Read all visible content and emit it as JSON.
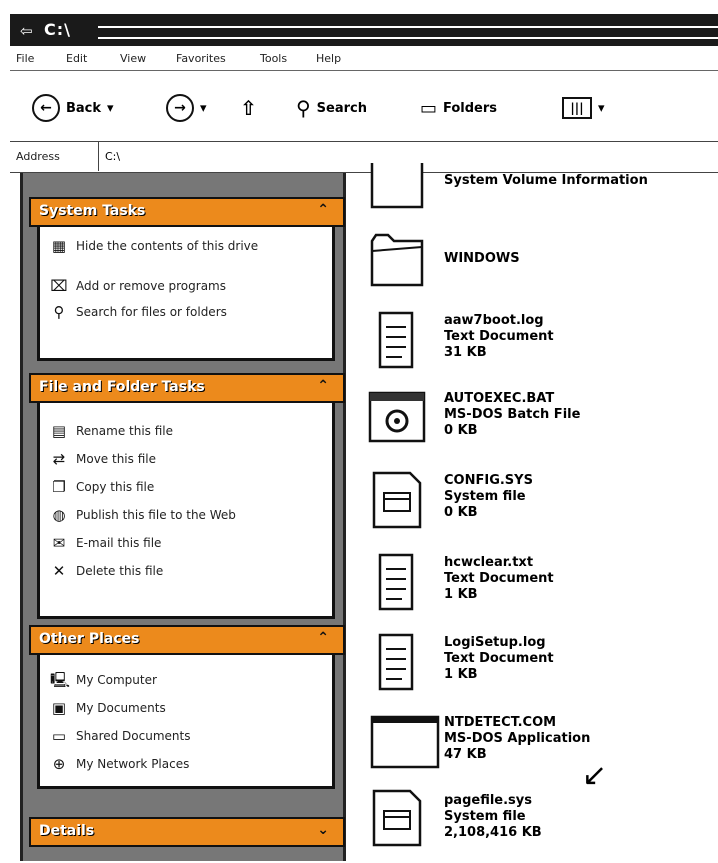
{
  "window": {
    "title": "C:\\"
  },
  "menu": [
    "File",
    "Edit",
    "View",
    "Favorites",
    "Tools",
    "Help"
  ],
  "toolbar": {
    "back": "Back",
    "search": "Search",
    "folders": "Folders"
  },
  "address": {
    "label": "Address",
    "value": "C:\\"
  },
  "system_tasks": {
    "title": "System Tasks",
    "items": [
      "Hide the contents of this drive",
      "Add or remove programs",
      "Search for files or folders"
    ]
  },
  "file_tasks": {
    "title": "File and Folder Tasks",
    "items": [
      "Rename this file",
      "Move this file",
      "Copy this file",
      "Publish this file to the Web",
      "E-mail this file",
      "Delete this file"
    ]
  },
  "other_places": {
    "title": "Other Places",
    "items": [
      "My Computer",
      "My Documents",
      "Shared Documents",
      "My Network Places"
    ]
  },
  "details": {
    "title": "Details"
  },
  "files": [
    {
      "name": "System Volume Information",
      "type": "",
      "size": "",
      "icon": "folder-icon"
    },
    {
      "name": "WINDOWS",
      "type": "",
      "size": "",
      "icon": "folder-icon"
    },
    {
      "name": "aaw7boot.log",
      "type": "Text Document",
      "size": "31 KB",
      "icon": "text-document-icon"
    },
    {
      "name": "AUTOEXEC.BAT",
      "type": "MS-DOS Batch File",
      "size": "0 KB",
      "icon": "batch-file-icon"
    },
    {
      "name": "CONFIG.SYS",
      "type": "System file",
      "size": "0 KB",
      "icon": "system-file-icon"
    },
    {
      "name": "hcwclear.txt",
      "type": "Text Document",
      "size": "1 KB",
      "icon": "text-document-icon"
    },
    {
      "name": "LogiSetup.log",
      "type": "Text Document",
      "size": "1 KB",
      "icon": "text-document-icon"
    },
    {
      "name": "NTDETECT.COM",
      "type": "MS-DOS Application",
      "size": "47 KB",
      "icon": "application-icon"
    },
    {
      "name": "pagefile.sys",
      "type": "System file",
      "size": "2,108,416 KB",
      "icon": "system-file-icon"
    }
  ],
  "colors": {
    "group_header": "#ec8a1c",
    "pane": "#777777"
  }
}
